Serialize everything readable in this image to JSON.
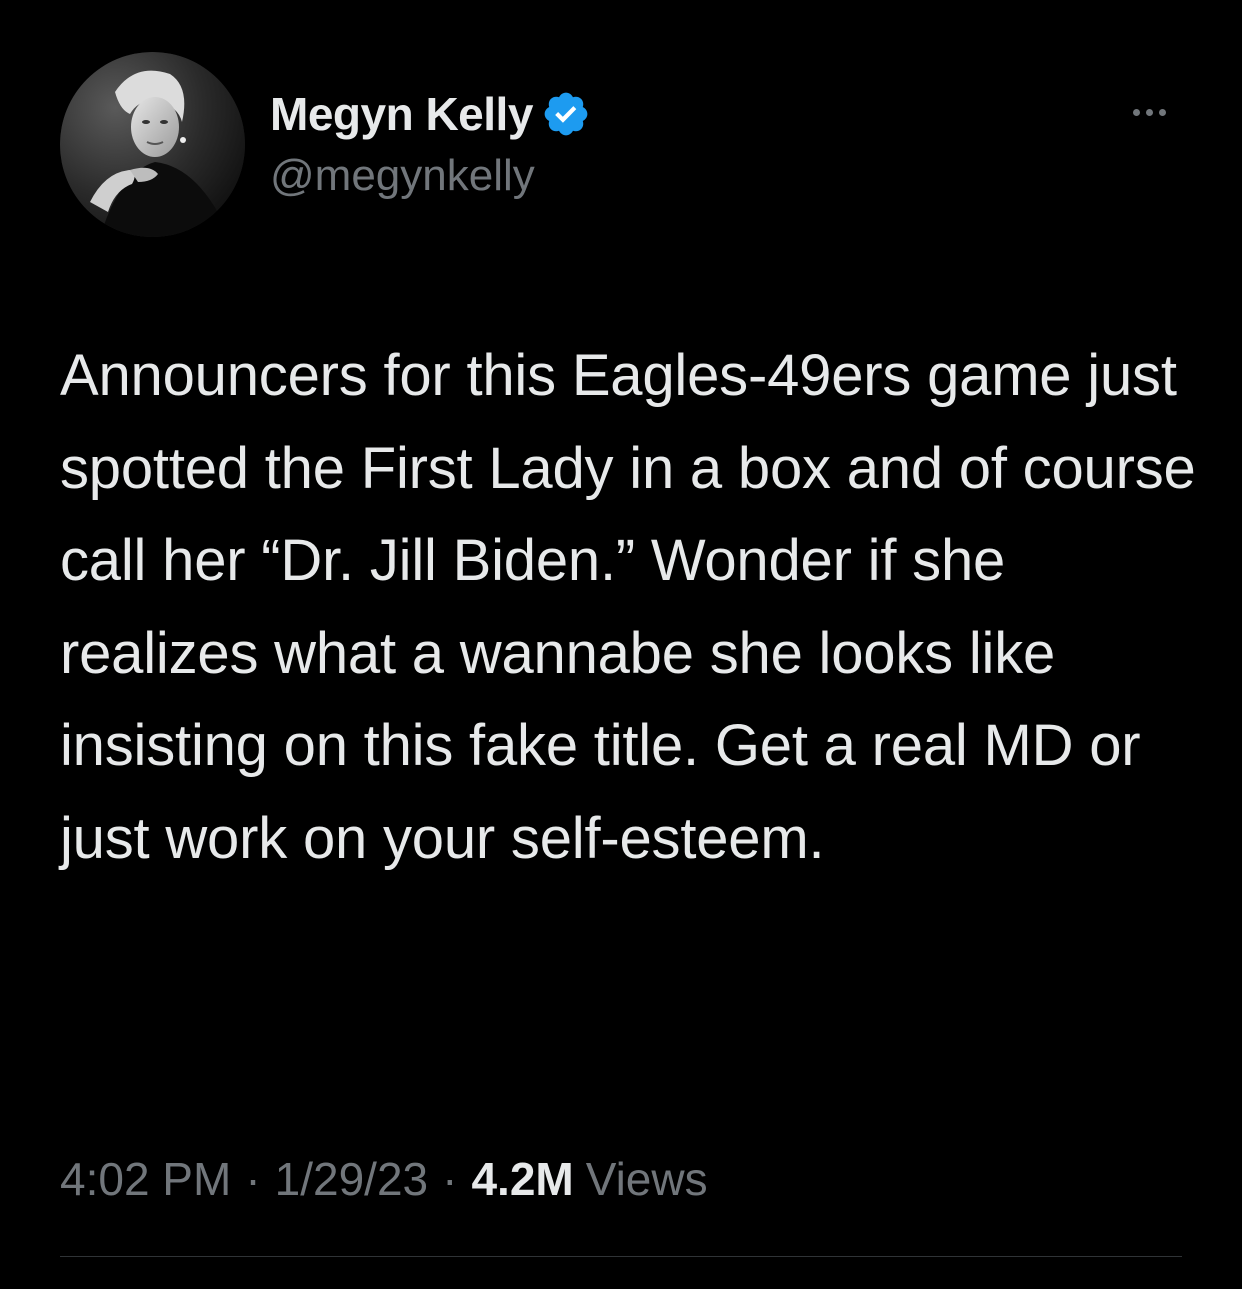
{
  "author": {
    "display_name": "Megyn Kelly",
    "handle": "@megynkelly",
    "verified": true,
    "verified_color": "#1d9bf0"
  },
  "icons": {
    "avatar": "profile-photo",
    "verified": "verified-badge-icon",
    "more": "more-options-icon"
  },
  "tweet": {
    "text": "Announcers for this Eagles-49ers game just spotted the First Lady in a box and of course call her “Dr. Jill Biden.” Wonder if she realizes what a wannabe she looks like insisting on this fake title. Get a real MD or just work on your self-esteem."
  },
  "meta": {
    "time": "4:02 PM",
    "separator": "·",
    "date": "1/29/23",
    "views_count": "4.2M",
    "views_label": "Views"
  },
  "colors": {
    "background": "#000000",
    "primary_text": "#e7e9ea",
    "secondary_text": "#71767b",
    "divider": "#2f3336"
  }
}
